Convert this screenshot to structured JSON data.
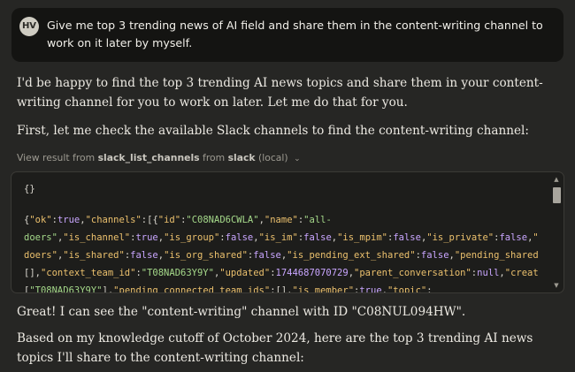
{
  "user_message": {
    "avatar_initials": "HV",
    "text": "Give me top 3 trending news of AI field and share them in the content-writing channel to work on it later by myself."
  },
  "assistant": {
    "para1": "I'd be happy to find the top 3 trending AI news topics and share them in your content-writing channel for you to work on later. Let me do that for you.",
    "para2": "First, let me check the available Slack channels to find the content-writing channel:",
    "para3": "Great! I can see the \"content-writing\" channel with ID \"C08NUL094HW\".",
    "para4": "Based on my knowledge cutoff of October 2024, here are the top 3 trending AI news topics I'll share to the content-writing channel:"
  },
  "tool": {
    "prefix": "View result from",
    "tool_name": "slack_list_channels",
    "from_word": "from",
    "server": "slack",
    "location": "(local)",
    "request": "{}"
  },
  "result_lines": [
    [
      [
        "p",
        "{"
      ],
      [
        "k",
        "\"ok\""
      ],
      [
        "p",
        ":"
      ],
      [
        "n",
        "true"
      ],
      [
        "p",
        ","
      ],
      [
        "k",
        "\"channels\""
      ],
      [
        "p",
        ":[{"
      ],
      [
        "k",
        "\"id\""
      ],
      [
        "p",
        ":"
      ],
      [
        "s",
        "\"C08NAD6CWLA\""
      ],
      [
        "p",
        ","
      ],
      [
        "k",
        "\"name\""
      ],
      [
        "p",
        ":"
      ],
      [
        "s",
        "\"all-"
      ]
    ],
    [
      [
        "s",
        "doers\""
      ],
      [
        "p",
        ","
      ],
      [
        "k",
        "\"is_channel\""
      ],
      [
        "p",
        ":"
      ],
      [
        "n",
        "true"
      ],
      [
        "p",
        ","
      ],
      [
        "k",
        "\"is_group\""
      ],
      [
        "p",
        ":"
      ],
      [
        "n",
        "false"
      ],
      [
        "p",
        ","
      ],
      [
        "k",
        "\"is_im\""
      ],
      [
        "p",
        ":"
      ],
      [
        "n",
        "false"
      ],
      [
        "p",
        ","
      ],
      [
        "k",
        "\"is_mpim\""
      ],
      [
        "p",
        ":"
      ],
      [
        "n",
        "false"
      ],
      [
        "p",
        ","
      ],
      [
        "k",
        "\"is_private\""
      ],
      [
        "p",
        ":"
      ],
      [
        "n",
        "false"
      ],
      [
        "p",
        ","
      ],
      [
        "k",
        "\""
      ]
    ],
    [
      [
        "k",
        "doers\""
      ],
      [
        "p",
        ","
      ],
      [
        "k",
        "\"is_shared\""
      ],
      [
        "p",
        ":"
      ],
      [
        "n",
        "false"
      ],
      [
        "p",
        ","
      ],
      [
        "k",
        "\"is_org_shared\""
      ],
      [
        "p",
        ":"
      ],
      [
        "n",
        "false"
      ],
      [
        "p",
        ","
      ],
      [
        "k",
        "\"is_pending_ext_shared\""
      ],
      [
        "p",
        ":"
      ],
      [
        "n",
        "false"
      ],
      [
        "p",
        ","
      ],
      [
        "k",
        "\"pending_shared"
      ]
    ],
    [
      [
        "p",
        "[],"
      ],
      [
        "k",
        "\"context_team_id\""
      ],
      [
        "p",
        ":"
      ],
      [
        "s",
        "\"T08NAD63Y9Y\""
      ],
      [
        "p",
        ","
      ],
      [
        "k",
        "\"updated\""
      ],
      [
        "p",
        ":"
      ],
      [
        "n",
        "1744687070729"
      ],
      [
        "p",
        ","
      ],
      [
        "k",
        "\"parent_conversation\""
      ],
      [
        "p",
        ":"
      ],
      [
        "n",
        "null"
      ],
      [
        "p",
        ","
      ],
      [
        "k",
        "\"creat"
      ]
    ],
    [
      [
        "p",
        "["
      ],
      [
        "s",
        "\"T08NAD63Y9Y\""
      ],
      [
        "p",
        "],"
      ],
      [
        "k",
        "\"pending_connected_team_ids\""
      ],
      [
        "p",
        ":[],"
      ],
      [
        "k",
        "\"is_member\""
      ],
      [
        "p",
        ":"
      ],
      [
        "n",
        "true"
      ],
      [
        "p",
        ","
      ],
      [
        "k",
        "\"topic\""
      ],
      [
        "p",
        ":"
      ]
    ]
  ],
  "colors": {
    "background": "#262624",
    "user_bubble": "#141412",
    "panel": "#1d1d1b",
    "json_key": "#ebc06d",
    "json_string": "#a5d98a",
    "json_literal": "#c9a6ff"
  },
  "icons": {
    "chevron": "chevron-down-icon",
    "scroll_up": "scroll-up-arrow-icon",
    "scroll_down": "scroll-down-arrow-icon"
  }
}
